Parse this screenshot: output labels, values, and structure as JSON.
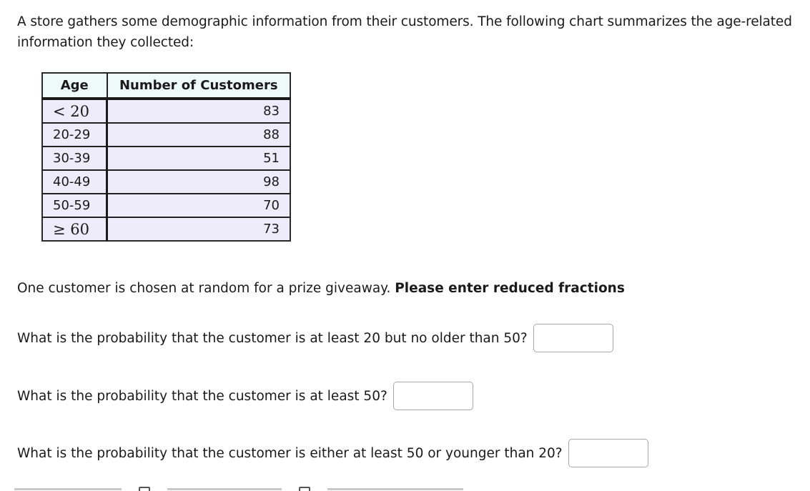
{
  "intro": {
    "text": "A store gathers some demographic information from their customers. The following chart summarizes the age-related information they collected:"
  },
  "table": {
    "headers": [
      "Age",
      "Number of Customers"
    ],
    "rows": [
      {
        "age": "< 20",
        "count": "83"
      },
      {
        "age": "20-29",
        "count": "88"
      },
      {
        "age": "30-39",
        "count": "51"
      },
      {
        "age": "40-49",
        "count": "98"
      },
      {
        "age": "50-59",
        "count": "70"
      },
      {
        "age": "≥ 60",
        "count": "73"
      }
    ]
  },
  "instruction": {
    "text": "One customer is chosen at random for a prize giveaway.",
    "bold": "Please enter reduced fractions"
  },
  "questions": [
    {
      "text": "What is the probability that the customer is at least 20 but no older than 50?",
      "value": ""
    },
    {
      "text": "What is the probability that the customer is at least 50?",
      "value": ""
    },
    {
      "text": "What is the probability that the customer is either at least 50 or younger than 20?",
      "value": ""
    }
  ],
  "footer": {
    "icons": [
      "document-icon",
      "message-icon"
    ]
  }
}
